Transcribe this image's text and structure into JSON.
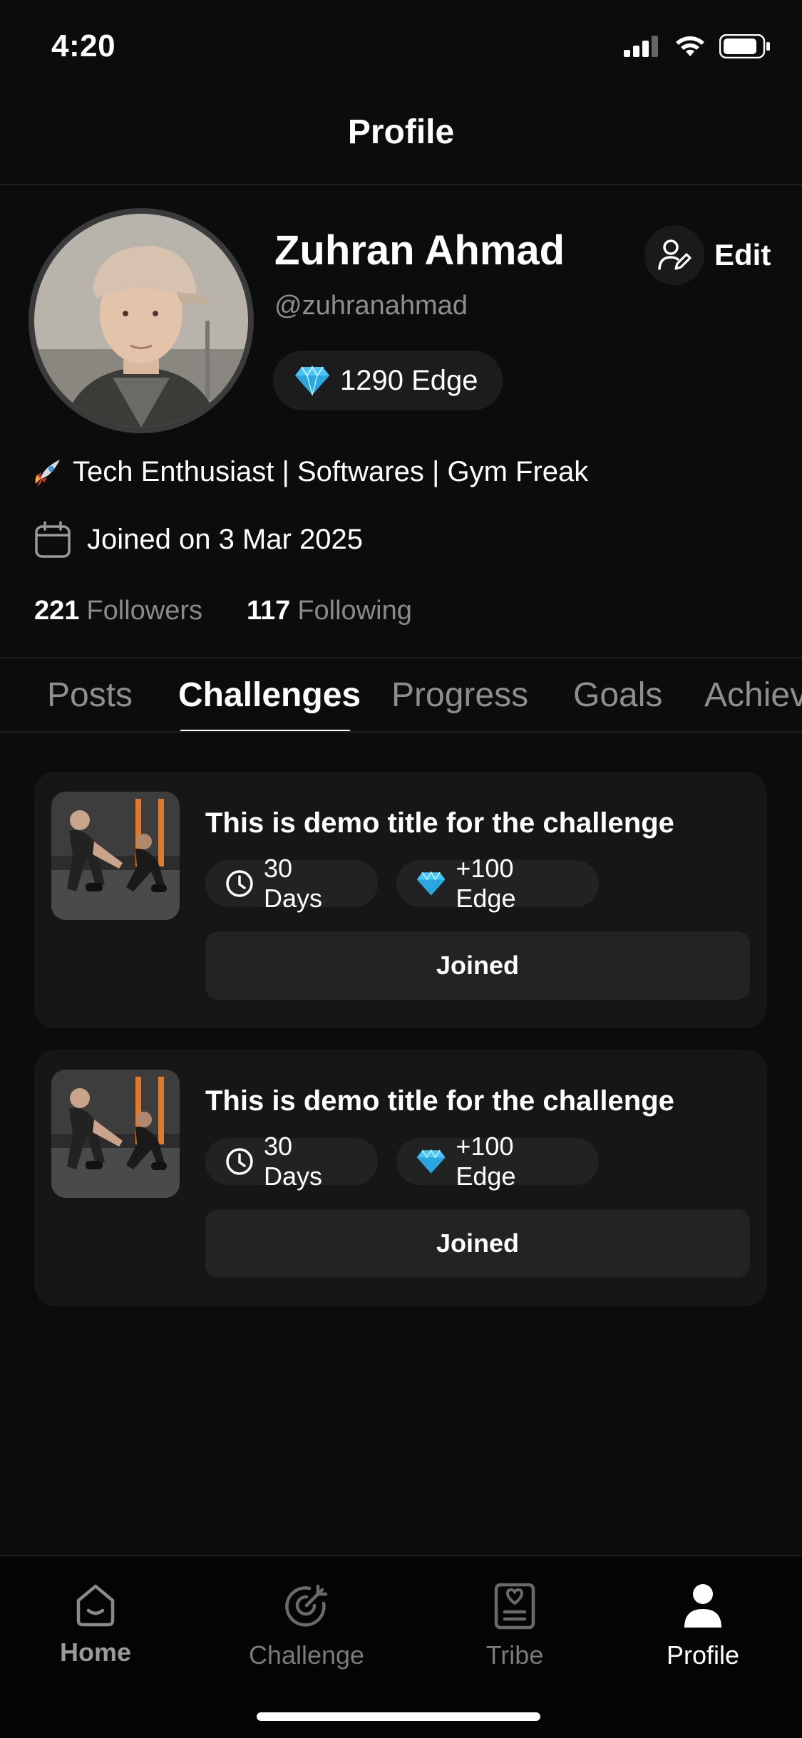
{
  "status_bar": {
    "time": "4:20"
  },
  "header": {
    "title": "Profile"
  },
  "profile": {
    "name": "Zuhran Ahmad",
    "handle": "@zuhranahmad",
    "edge_points": "1290 Edge",
    "edit_label": "Edit",
    "bio": "Tech Enthusiast | Softwares | Gym Freak",
    "bio_emoji": "🚀",
    "joined": "Joined on 3 Mar 2025",
    "followers_count": "221",
    "followers_label": "Followers",
    "following_count": "117",
    "following_label": "Following"
  },
  "tabs": [
    {
      "label": "Posts",
      "active": false
    },
    {
      "label": "Challenges",
      "active": true
    },
    {
      "label": "Progress",
      "active": false
    },
    {
      "label": "Goals",
      "active": false
    },
    {
      "label": "Achiev",
      "active": false
    }
  ],
  "challenges": [
    {
      "title": "This is demo title for the challenge",
      "duration": "30 Days",
      "reward": "+100 Edge",
      "button": "Joined"
    },
    {
      "title": "This is demo title for the challenge",
      "duration": "30 Days",
      "reward": "+100 Edge",
      "button": "Joined"
    }
  ],
  "bottom_nav": [
    {
      "label": "Home",
      "icon": "home-icon",
      "active": false
    },
    {
      "label": "Challenge",
      "icon": "target-icon",
      "active": false
    },
    {
      "label": "Tribe",
      "icon": "tribe-icon",
      "active": false
    },
    {
      "label": "Profile",
      "icon": "user-icon",
      "active": true
    }
  ],
  "colors": {
    "background": "#0c0c0c",
    "card": "#161616",
    "chip": "#222222",
    "muted_text": "#8e8e8e",
    "diamond": "#3fc3ff"
  }
}
